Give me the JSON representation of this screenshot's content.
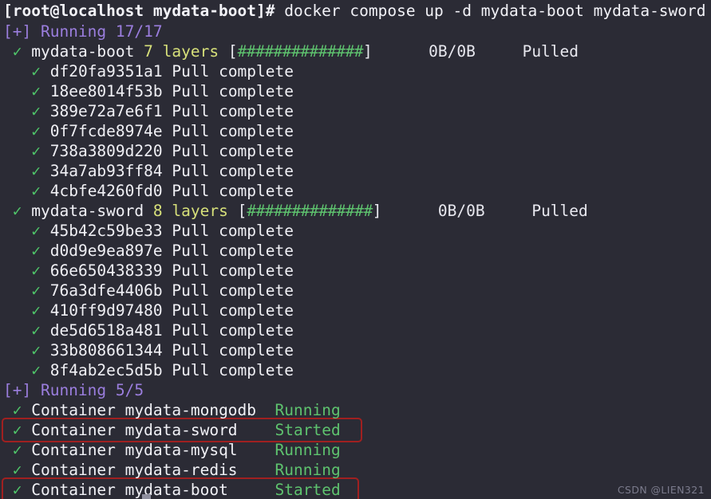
{
  "terminal": {
    "background_color": "#2b2b35",
    "prompt": {
      "user_host_path": "[root@localhost mydata-boot]#",
      "command": " docker compose up -d mydata-boot mydata-sword"
    },
    "watermark": "CSDN @LIEN321",
    "colors": {
      "foreground": "#d8d8e0",
      "green": "#5ec26e",
      "purple": "#9b7ede",
      "yellow": "#d7e07a",
      "annotation_red": "#a02020"
    }
  },
  "pull_phase": {
    "header": "[+] Running 17/17",
    "services": [
      {
        "check": "✓",
        "name": "mydata-boot",
        "layer_count": "7",
        "layers_word": "layers",
        "bar_open": "[",
        "bar": "##############",
        "bar_close": "]",
        "size": "0B/0B",
        "status": "Pulled",
        "gap_before_size": "      ",
        "gap_before_status": "     ",
        "layers": [
          {
            "check": "✓",
            "id": "df20fa9351a1",
            "status": "Pull complete"
          },
          {
            "check": "✓",
            "id": "18ee8014f53b",
            "status": "Pull complete"
          },
          {
            "check": "✓",
            "id": "389e72a7e6f1",
            "status": "Pull complete"
          },
          {
            "check": "✓",
            "id": "0f7fcde8974e",
            "status": "Pull complete"
          },
          {
            "check": "✓",
            "id": "738a3809d220",
            "status": "Pull complete"
          },
          {
            "check": "✓",
            "id": "34a7ab93ff84",
            "status": "Pull complete"
          },
          {
            "check": "✓",
            "id": "4cbfe4260fd0",
            "status": "Pull complete"
          }
        ]
      },
      {
        "check": "✓",
        "name": "mydata-sword",
        "layer_count": "8",
        "layers_word": "layers",
        "bar_open": "[",
        "bar": "##############",
        "bar_close": "]",
        "size": "0B/0B",
        "status": "Pulled",
        "gap_before_size": "      ",
        "gap_before_status": "     ",
        "layers": [
          {
            "check": "✓",
            "id": "45b42c59be33",
            "status": "Pull complete"
          },
          {
            "check": "✓",
            "id": "d0d9e9ea897e",
            "status": "Pull complete"
          },
          {
            "check": "✓",
            "id": "66e650438339",
            "status": "Pull complete"
          },
          {
            "check": "✓",
            "id": "76a3dfe4406b",
            "status": "Pull complete"
          },
          {
            "check": "✓",
            "id": "410ff9d97480",
            "status": "Pull complete"
          },
          {
            "check": "✓",
            "id": "de5d6518a481",
            "status": "Pull complete"
          },
          {
            "check": "✓",
            "id": "33b808661344",
            "status": "Pull complete"
          },
          {
            "check": "✓",
            "id": "8f4ab2ec5d5b",
            "status": "Pull complete"
          }
        ]
      }
    ]
  },
  "run_phase": {
    "header": "[+] Running 5/5",
    "containers": [
      {
        "check": "✓",
        "kind": "Container",
        "name": "mydata-mongodb",
        "pad": "  ",
        "status": "Running",
        "highlighted": false
      },
      {
        "check": "✓",
        "kind": "Container",
        "name": "mydata-sword",
        "pad": "    ",
        "status": "Started",
        "highlighted": true
      },
      {
        "check": "✓",
        "kind": "Container",
        "name": "mydata-mysql",
        "pad": "    ",
        "status": "Running",
        "highlighted": false
      },
      {
        "check": "✓",
        "kind": "Container",
        "name": "mydata-redis",
        "pad": "    ",
        "status": "Running",
        "highlighted": false
      },
      {
        "check": "✓",
        "kind": "Container",
        "name": "mydata-boot",
        "pad": "     ",
        "status": "Started",
        "highlighted": true
      }
    ]
  }
}
